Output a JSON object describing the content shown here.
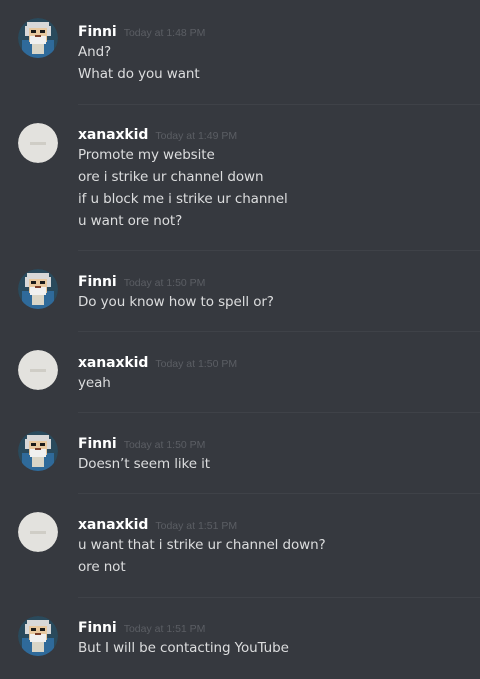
{
  "messages": [
    {
      "user": "Finni",
      "avatar": "pixel-art-old-man-avatar",
      "time": "Today at 1:48 PM",
      "lines": [
        "And?",
        "What do you want"
      ]
    },
    {
      "user": "xanaxkid",
      "avatar": "default-placeholder-avatar",
      "time": "Today at 1:49 PM",
      "lines": [
        "Promote my website",
        "ore i strike ur channel down",
        "if u block me i strike ur channel",
        "u want ore not?"
      ]
    },
    {
      "user": "Finni",
      "avatar": "pixel-art-old-man-avatar",
      "time": "Today at 1:50 PM",
      "lines": [
        "Do you know how to spell or?"
      ]
    },
    {
      "user": "xanaxkid",
      "avatar": "default-placeholder-avatar",
      "time": "Today at 1:50 PM",
      "lines": [
        "yeah"
      ]
    },
    {
      "user": "Finni",
      "avatar": "pixel-art-old-man-avatar",
      "time": "Today at 1:50 PM",
      "lines": [
        "Doesn’t seem like it"
      ]
    },
    {
      "user": "xanaxkid",
      "avatar": "default-placeholder-avatar",
      "time": "Today at 1:51 PM",
      "lines": [
        "u want that i strike ur channel down?",
        "ore not"
      ]
    },
    {
      "user": "Finni",
      "avatar": "pixel-art-old-man-avatar",
      "time": "Today at 1:51 PM",
      "lines": [
        "But I will be contacting YouTube"
      ]
    }
  ],
  "colors": {
    "background": "#36393f",
    "username": "#ffffff",
    "message_text": "#dcddde",
    "timestamp": "#5b5e64",
    "divider": "#3f4248",
    "placeholder_avatar": "#e3e2de"
  }
}
